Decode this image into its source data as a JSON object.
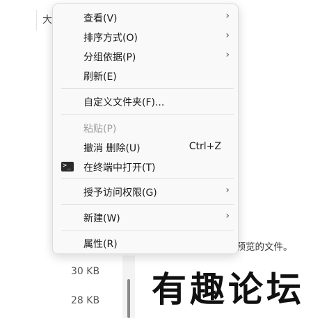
{
  "background": {
    "column_header_fragment": "大",
    "preview_message_fragment": "要预览的文件。",
    "file_sizes": [
      "30 KB",
      "28 KB"
    ],
    "watermark": "有趣论坛"
  },
  "context_menu": {
    "items": [
      {
        "label": "查看(V)",
        "submenu": true,
        "icon": "chevron-right-icon"
      },
      {
        "label": "排序方式(O)",
        "submenu": true,
        "icon": "chevron-right-icon"
      },
      {
        "label": "分组依据(P)",
        "submenu": true,
        "icon": "chevron-right-icon"
      },
      {
        "label": "刷新(E)"
      },
      {
        "label": "自定义文件夹(F)..."
      },
      {
        "label": "粘贴(P)",
        "disabled": true
      },
      {
        "label": "撤消 删除(U)",
        "shortcut": "Ctrl+Z"
      },
      {
        "label": "在终端中打开(T)",
        "icon": "terminal-icon"
      },
      {
        "label": "授予访问权限(G)",
        "submenu": true,
        "icon": "chevron-right-icon"
      },
      {
        "label": "新建(W)",
        "submenu": true,
        "icon": "chevron-right-icon"
      },
      {
        "label": "属性(R)"
      }
    ],
    "chevron_glyph": "›",
    "terminal_prompt_glyph": ">_"
  }
}
